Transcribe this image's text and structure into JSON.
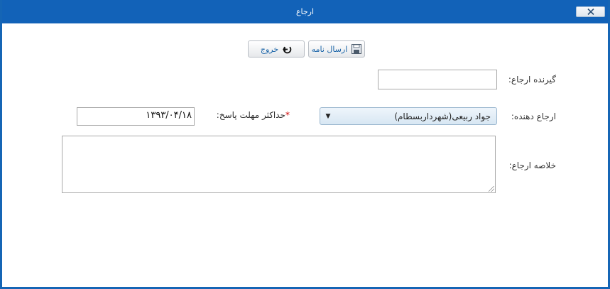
{
  "window": {
    "title": "ارجاع"
  },
  "toolbar": {
    "send_label": "ارسال نامه",
    "exit_label": "خروج"
  },
  "form": {
    "recipient_label": "گیرنده ارجاع:",
    "recipient_value": "",
    "referrer_label": "ارجاع دهنده:",
    "referrer_value": "جواد ربیعی(شهرداربسطام)",
    "deadline_required": "*",
    "deadline_label": "حداکثر مهلت پاسخ:",
    "deadline_value": "۱۳۹۳/۰۴/۱۸",
    "summary_label": "خلاصه ارجاع:",
    "summary_value": ""
  },
  "icons": {
    "send": "save-icon",
    "exit": "exit-icon",
    "close": "close-icon",
    "dropdown": "caret-down-icon"
  },
  "colors": {
    "titlebar": "#1262b8",
    "button_text": "#1a64a8",
    "required": "#d00000"
  }
}
